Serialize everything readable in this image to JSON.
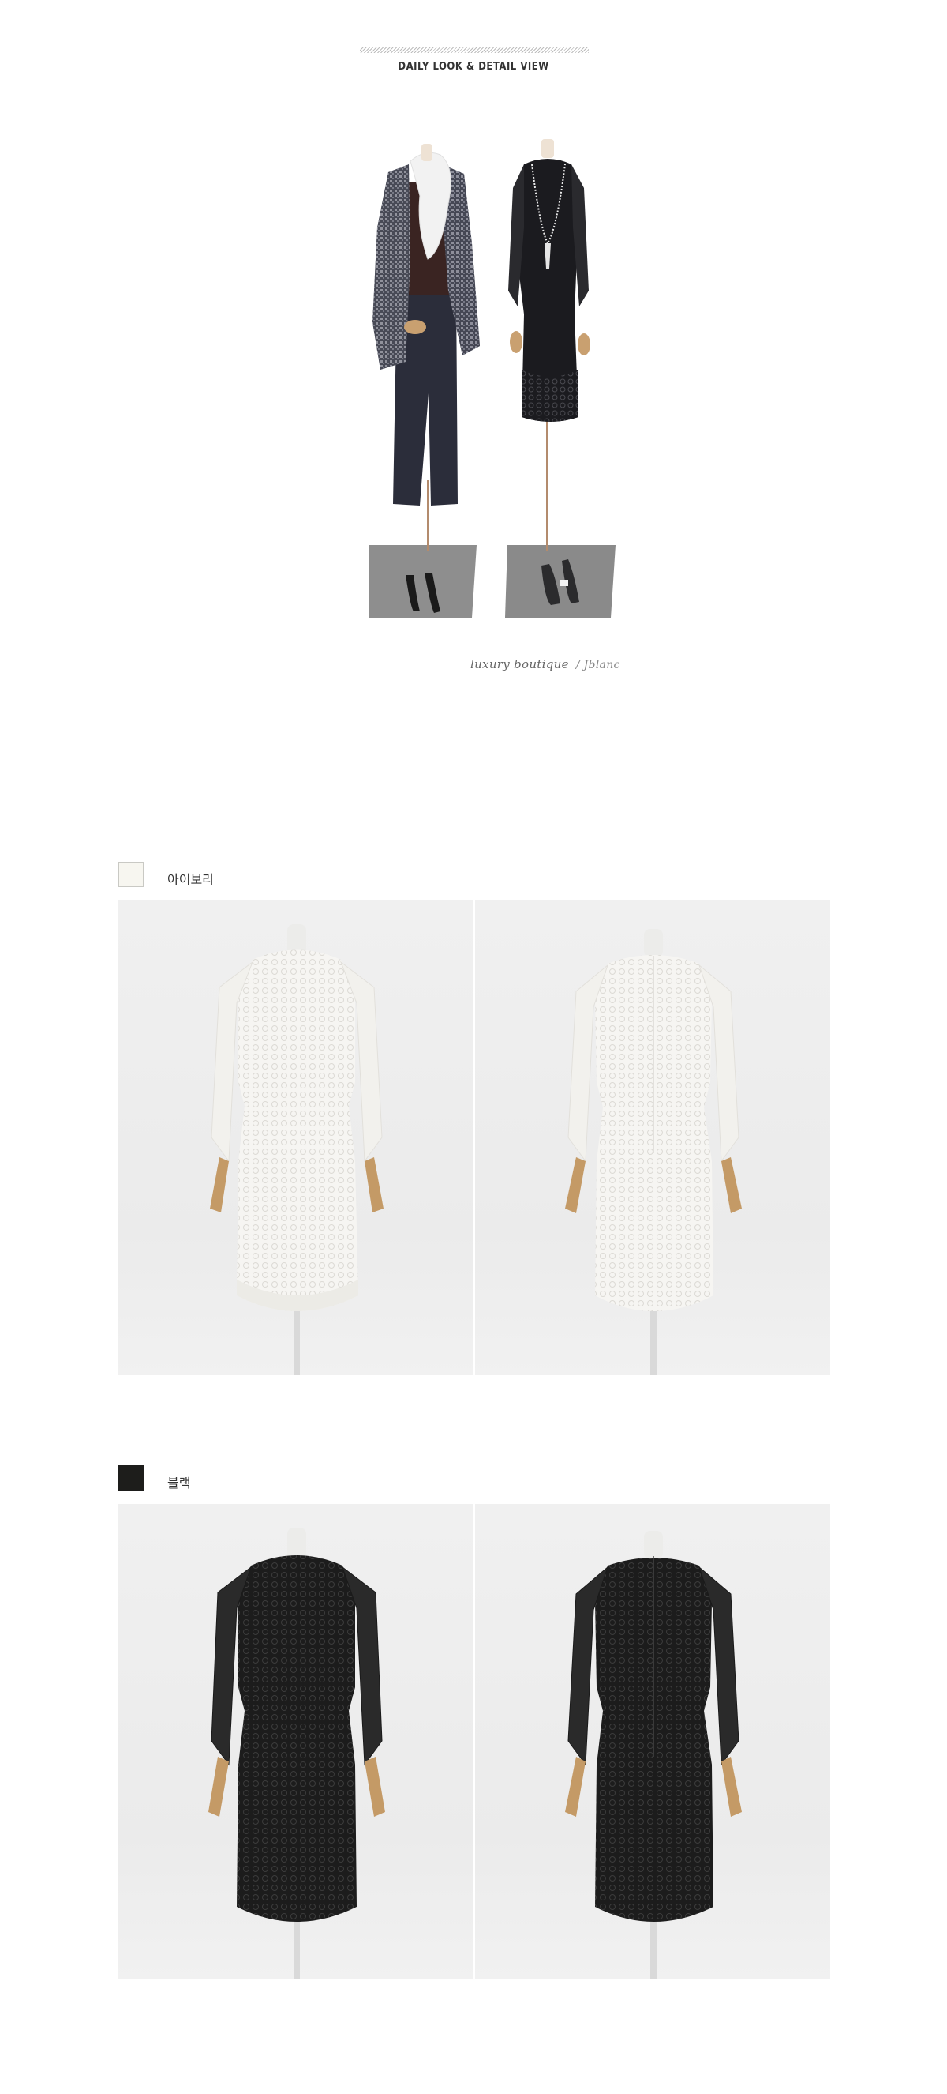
{
  "header": {
    "title": "DAILY LOOK & DETAIL VIEW"
  },
  "brand": {
    "text": "luxury boutique",
    "signature": "/ Jblanc"
  },
  "colors": [
    {
      "name": "아이보리",
      "swatch": "#f7f6f0"
    },
    {
      "name": "블랙",
      "swatch": "#1d1d1b"
    }
  ],
  "icons": {
    "ivory_front": "ivory-dress-front-icon",
    "ivory_back": "ivory-dress-back-icon",
    "black_front": "black-dress-front-icon",
    "black_back": "black-dress-back-icon"
  }
}
